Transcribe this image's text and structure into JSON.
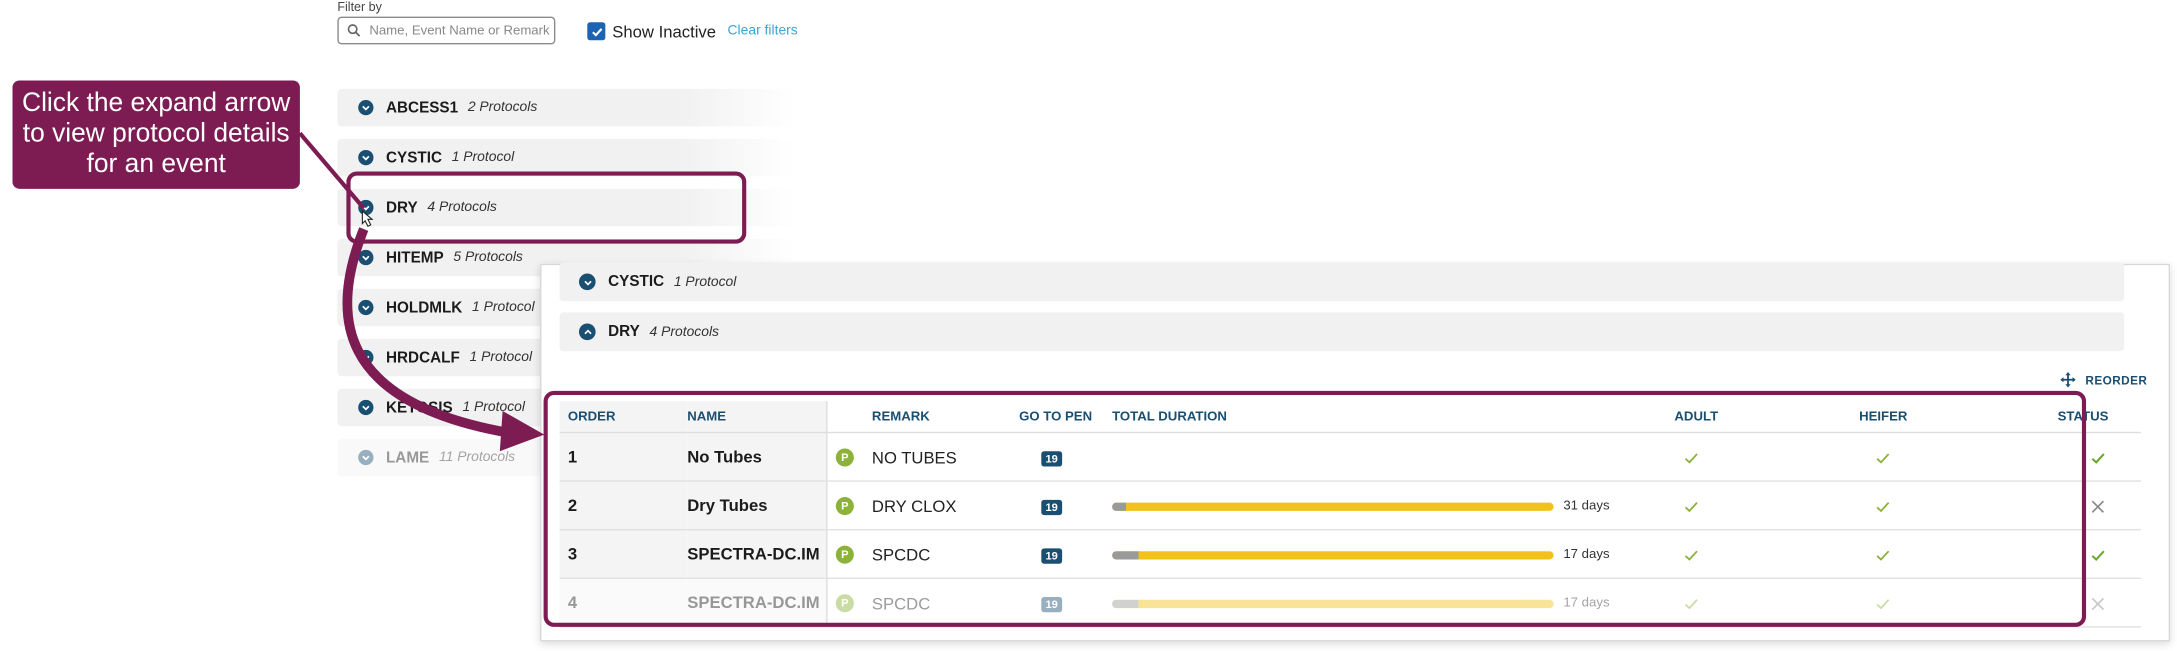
{
  "filter": {
    "label": "Filter by",
    "search_placeholder": "Name, Event Name or Remark",
    "show_inactive_label": "Show Inactive",
    "show_inactive_checked": true,
    "clear_filters_label": "Clear filters"
  },
  "events": [
    {
      "name": "ABCESS1",
      "count": "2 Protocols"
    },
    {
      "name": "CYSTIC",
      "count": "1 Protocol"
    },
    {
      "name": "DRY",
      "count": "4 Protocols"
    },
    {
      "name": "HITEMP",
      "count": "5 Protocols"
    },
    {
      "name": "HOLDMLK",
      "count": "1 Protocol"
    },
    {
      "name": "HRDCALF",
      "count": "1 Protocol"
    },
    {
      "name": "KETOSIS",
      "count": "1 Protocol"
    },
    {
      "name": "LAME",
      "count": "11 Protocols"
    }
  ],
  "callout": {
    "text": "Click the expand arrow to view protocol details for an event"
  },
  "detail": {
    "rows": [
      {
        "name": "CYSTIC",
        "count": "1 Protocol"
      },
      {
        "name": "DRY",
        "count": "4 Protocols"
      }
    ],
    "reorder_label": "REORDER",
    "columns": [
      "ORDER",
      "NAME",
      "REMARK",
      "GO TO PEN",
      "TOTAL DURATION",
      "ADULT",
      "HEIFER",
      "STATUS"
    ],
    "protocols": [
      {
        "order": "1",
        "name": "No Tubes",
        "badge": "P",
        "remark": "NO TUBES",
        "pen": "19",
        "duration": null,
        "gray_fraction": 0,
        "days": "",
        "adult": true,
        "heifer": true,
        "status": true
      },
      {
        "order": "2",
        "name": "Dry Tubes",
        "badge": "P",
        "remark": "DRY CLOX",
        "pen": "19",
        "duration": 31,
        "gray_fraction": 0.03,
        "days": "31 days",
        "adult": true,
        "heifer": true,
        "status": false
      },
      {
        "order": "3",
        "name": "SPECTRA-DC.IM",
        "badge": "P",
        "remark": "SPCDC",
        "pen": "19",
        "duration": 17,
        "gray_fraction": 0.06,
        "days": "17 days",
        "adult": true,
        "heifer": true,
        "status": true
      },
      {
        "order": "4",
        "name": "SPECTRA-DC.IM",
        "badge": "P",
        "remark": "SPCDC",
        "pen": "19",
        "duration": 17,
        "gray_fraction": 0.06,
        "days": "17 days",
        "adult": true,
        "heifer": true,
        "status": false
      }
    ]
  },
  "colors": {
    "accent_navy": "#1a4f72",
    "annotation_purple": "#7d1c52",
    "bar_yellow": "#f2c21b",
    "badge_green": "#8cb23a",
    "link_blue": "#3aa6d0",
    "check_green": "#8cb23a"
  }
}
